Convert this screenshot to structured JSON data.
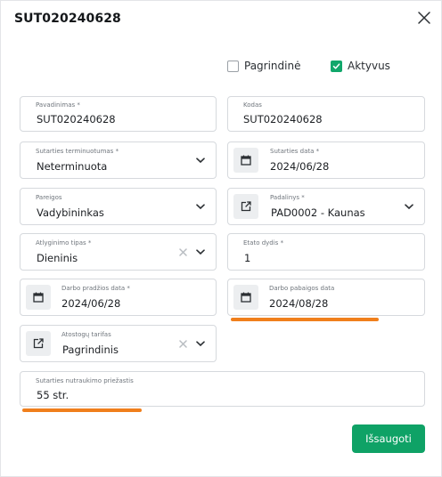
{
  "dialog": {
    "title": "SUT020240628",
    "close_icon": "close-icon"
  },
  "checkboxes": {
    "pagrindine": {
      "label": "Pagrindinė",
      "checked": false
    },
    "aktyvus": {
      "label": "Aktyvus",
      "checked": true
    }
  },
  "fields": {
    "pavadinimas": {
      "label": "Pavadinimas",
      "required": "*",
      "value": "SUT020240628"
    },
    "kodas": {
      "label": "Kodas",
      "value": "SUT020240628"
    },
    "terminuotumas": {
      "label": "Sutarties terminuotumas",
      "required": "*",
      "value": "Neterminuota"
    },
    "sutarties_data": {
      "label": "Sutarties data",
      "required": "*",
      "value": "2024/06/28",
      "icon": "calendar-icon"
    },
    "pareigos": {
      "label": "Pareigos",
      "value": "Vadybininkas"
    },
    "padalinys": {
      "label": "Padalinys",
      "required": "*",
      "value": "PAD0002 - Kaunas",
      "icon": "external-link-icon"
    },
    "atlyginimo_tipas": {
      "label": "Atlyginimo tipas",
      "required": "*",
      "value": "Dieninis"
    },
    "etato_dydis": {
      "label": "Etato dydis",
      "required": "*",
      "value": "1"
    },
    "darbo_pradzios_data": {
      "label": "Darbo pradžios data",
      "required": "*",
      "value": "2024/06/28",
      "icon": "calendar-icon"
    },
    "darbo_pabaigos_data": {
      "label": "Darbo pabaigos data",
      "value": "2024/08/28",
      "icon": "calendar-icon"
    },
    "atostogu_tarifas": {
      "label": "Atostogų tarifas",
      "value": "Pagrindinis",
      "icon": "external-link-icon"
    },
    "nutraukimo_priezastis": {
      "label": "Sutarties nutraukimo priežastis",
      "value": "55 str."
    }
  },
  "actions": {
    "save_label": "Išsaugoti"
  },
  "colors": {
    "accent": "#0fa266",
    "highlight": "#f07f1c"
  }
}
